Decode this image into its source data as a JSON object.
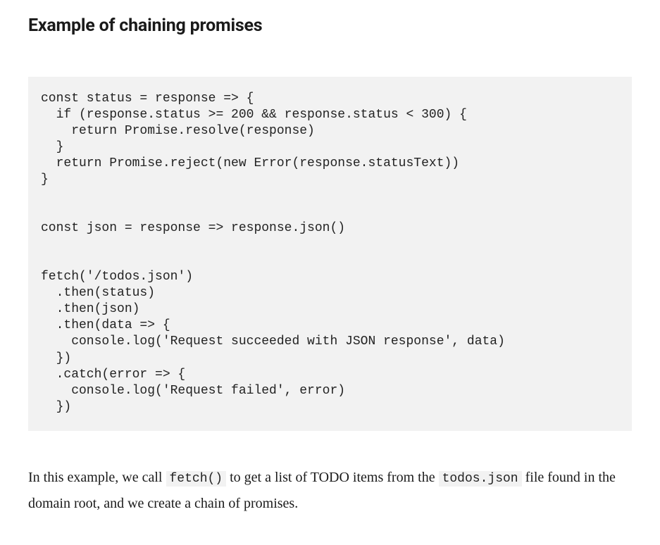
{
  "heading": "Example of chaining promises",
  "code": "const status = response => {\n  if (response.status >= 200 && response.status < 300) {\n    return Promise.resolve(response)\n  }\n  return Promise.reject(new Error(response.statusText))\n}\n\n\nconst json = response => response.json()\n\n\nfetch('/todos.json')\n  .then(status)\n  .then(json)\n  .then(data => {\n    console.log('Request succeeded with JSON response', data)\n  })\n  .catch(error => {\n    console.log('Request failed', error)\n  })",
  "paragraph": {
    "p1": "In this example, we call ",
    "c1": "fetch()",
    "p2": " to get a list of TODO items from the ",
    "c2": "todos.json",
    "p3": " file found in the domain root, and we create a chain of promises."
  }
}
